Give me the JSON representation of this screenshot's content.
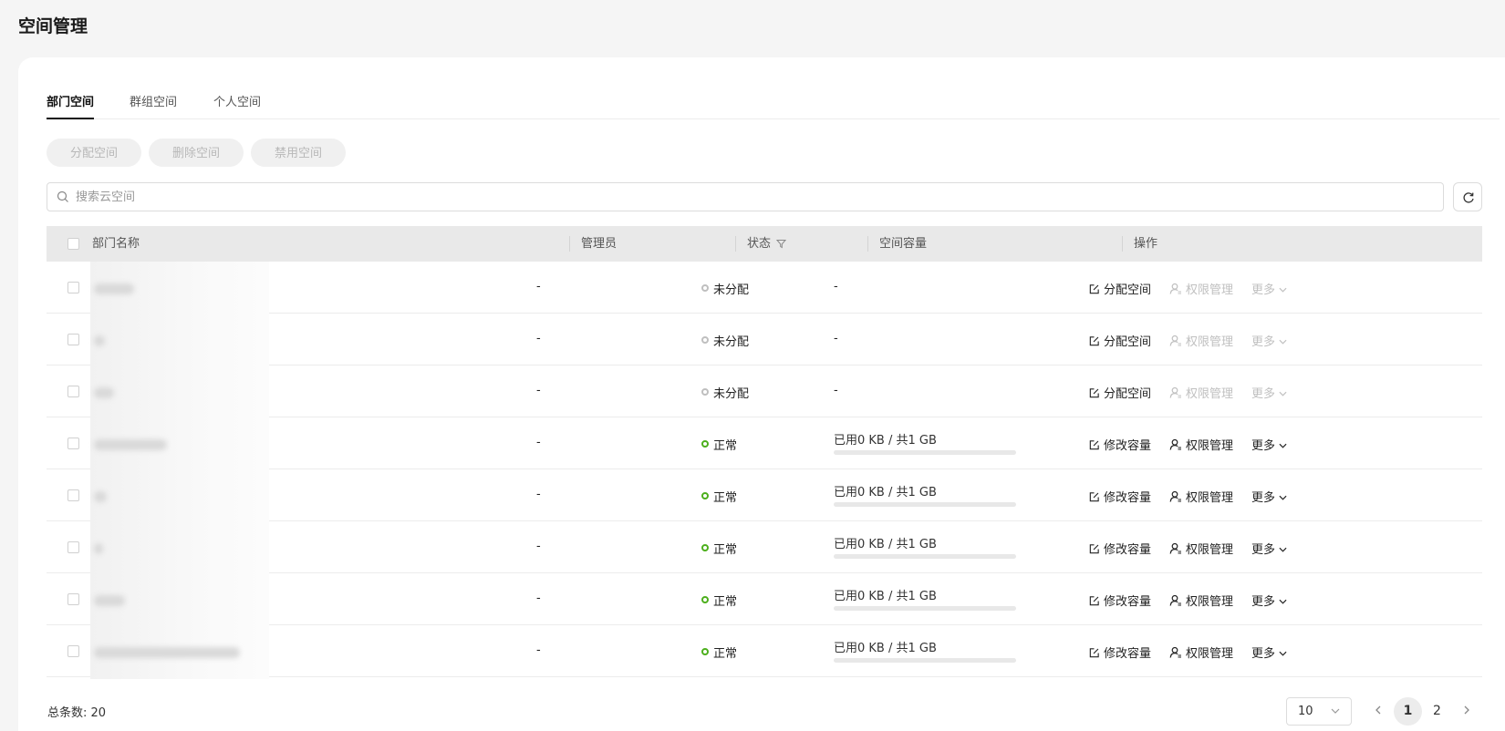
{
  "page": {
    "title": "空间管理"
  },
  "tabs": [
    {
      "label": "部门空间",
      "active": true
    },
    {
      "label": "群组空间",
      "active": false
    },
    {
      "label": "个人空间",
      "active": false
    }
  ],
  "toolbar": {
    "assign_label": "分配空间",
    "delete_label": "删除空间",
    "disable_label": "禁用空间"
  },
  "search": {
    "placeholder": "搜索云空间"
  },
  "table": {
    "headers": {
      "name": "部门名称",
      "admin": "管理员",
      "status": "状态",
      "capacity": "空间容量",
      "actions": "操作"
    },
    "rows": [
      {
        "admin": "-",
        "status": "未分配",
        "state": "unassigned",
        "capacity": "-",
        "used_fraction": 0,
        "action1": "分配空间",
        "action2": "权限管理",
        "more": "更多"
      },
      {
        "admin": "-",
        "status": "未分配",
        "state": "unassigned",
        "capacity": "-",
        "used_fraction": 0,
        "action1": "分配空间",
        "action2": "权限管理",
        "more": "更多"
      },
      {
        "admin": "-",
        "status": "未分配",
        "state": "unassigned",
        "capacity": "-",
        "used_fraction": 0,
        "action1": "分配空间",
        "action2": "权限管理",
        "more": "更多"
      },
      {
        "admin": "-",
        "status": "正常",
        "state": "normal",
        "capacity": "已用0 KB / 共1 GB",
        "used_fraction": 0,
        "action1": "修改容量",
        "action2": "权限管理",
        "more": "更多"
      },
      {
        "admin": "-",
        "status": "正常",
        "state": "normal",
        "capacity": "已用0 KB / 共1 GB",
        "used_fraction": 0,
        "action1": "修改容量",
        "action2": "权限管理",
        "more": "更多"
      },
      {
        "admin": "-",
        "status": "正常",
        "state": "normal",
        "capacity": "已用0 KB / 共1 GB",
        "used_fraction": 0,
        "action1": "修改容量",
        "action2": "权限管理",
        "more": "更多"
      },
      {
        "admin": "-",
        "status": "正常",
        "state": "normal",
        "capacity": "已用0 KB / 共1 GB",
        "used_fraction": 0,
        "action1": "修改容量",
        "action2": "权限管理",
        "more": "更多"
      },
      {
        "admin": "-",
        "status": "正常",
        "state": "normal",
        "capacity": "已用0 KB / 共1 GB",
        "used_fraction": 0,
        "action1": "修改容量",
        "action2": "权限管理",
        "more": "更多"
      }
    ]
  },
  "footer": {
    "total_label": "总条数:",
    "total_value": "20",
    "page_size": "10",
    "pages": [
      "1",
      "2"
    ],
    "current_page": "1"
  },
  "colors": {
    "status_normal": "#4caf1c",
    "status_unassigned": "#bfbfbf"
  }
}
